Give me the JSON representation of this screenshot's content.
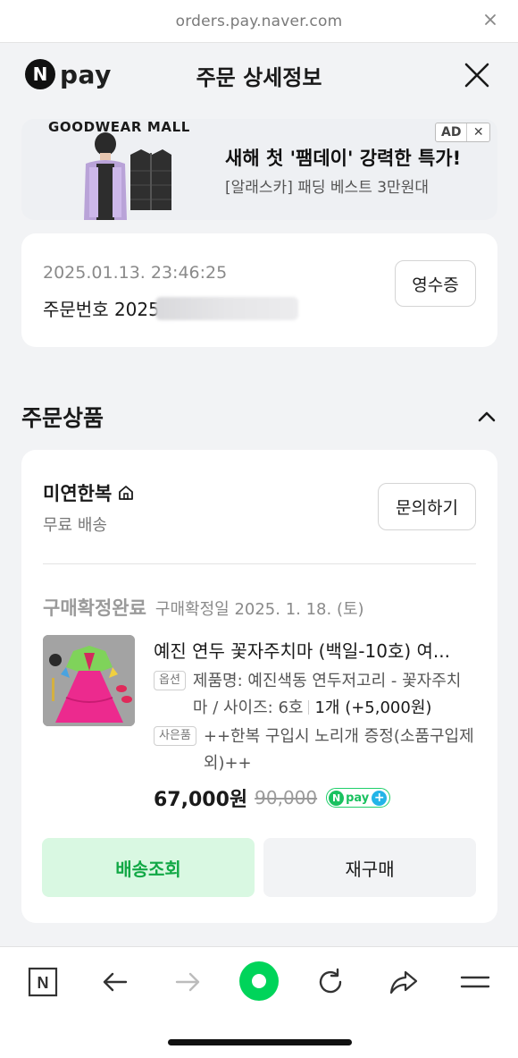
{
  "browser": {
    "url": "orders.pay.naver.com"
  },
  "header": {
    "logo_letter": "N",
    "logo_text": "pay",
    "title": "주문 상세정보",
    "close_icon": "close-icon"
  },
  "ad": {
    "brand": "GOODWEAR MALL",
    "title": "새해 첫 '팸데이' 강력한 특가!",
    "subtitle": "[알래스카] 패딩 베스트 3만원대",
    "badge_label": "AD",
    "badge_close": "✕"
  },
  "order": {
    "datetime": "2025.01.13. 23:46:25",
    "order_number_label": "주문번호 2025",
    "receipt_label": "영수증"
  },
  "section": {
    "title": "주문상품",
    "toggle_icon": "chevron-up-icon"
  },
  "product_card": {
    "store_name": "미연한복",
    "store_icon": "home-icon",
    "shipping": "무료 배송",
    "inquiry_label": "문의하기",
    "status": "구매확정완료",
    "status_date": "구매확정일 2025. 1. 18. (토)",
    "product_name": "예진 연두 꽃자주치마 (백일-10호) 여...",
    "option_tag": "옵션",
    "option_text": "제품명: 예진색동 연두저고리 - 꽃자주치마 / 사이즈: 6호",
    "option_qty": "1개 (+5,000원)",
    "gift_tag": "사은품",
    "gift_text": "++한복 구입시 노리개 증정(소품구입제외)++",
    "price": "67,000원",
    "original_price": "90,000",
    "npay_n": "N",
    "npay_pay": "pay",
    "npay_plus": "+",
    "track_label": "배송조회",
    "rebuy_label": "재구매"
  },
  "bottom_nav": {
    "items": [
      "naver-home-icon",
      "back-arrow-icon",
      "forward-arrow-icon",
      "green-dot-icon",
      "refresh-icon",
      "share-icon",
      "menu-icon"
    ],
    "home_letter": "N"
  },
  "colors": {
    "accent_green": "#11a845",
    "track_bg": "#d9f8e2",
    "npay_green": "#19c15f",
    "background": "#f2f3f5"
  }
}
